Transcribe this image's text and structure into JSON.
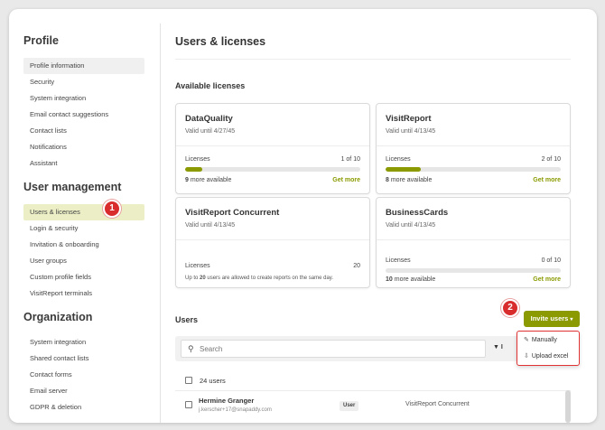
{
  "sidebar": {
    "profile": {
      "title": "Profile",
      "items": [
        "Profile information",
        "Security",
        "System integration",
        "Email contact suggestions",
        "Contact lists",
        "Notifications",
        "Assistant"
      ]
    },
    "user_management": {
      "title": "User management",
      "items": [
        "Users & licenses",
        "Login & security",
        "Invitation & onboarding",
        "User groups",
        "Custom profile fields",
        "VisitReport terminals"
      ]
    },
    "organization": {
      "title": "Organization",
      "items": [
        "System integration",
        "Shared contact lists",
        "Contact forms",
        "Email server",
        "GDPR & deletion"
      ]
    }
  },
  "steps": {
    "one": "1",
    "two": "2"
  },
  "main": {
    "title": "Users & licenses",
    "licenses_title": "Available licenses",
    "cards": [
      {
        "name": "DataQuality",
        "valid": "Valid until 4/27/45",
        "label": "Licenses",
        "count": "1 of 10",
        "fill": 0.1,
        "avail_num": "9",
        "avail_text": " more available",
        "more": "Get more"
      },
      {
        "name": "VisitReport",
        "valid": "Valid until 4/13/45",
        "label": "Licenses",
        "count": "2 of 10",
        "fill": 0.2,
        "avail_num": "8",
        "avail_text": " more available",
        "more": "Get more"
      },
      {
        "name": "VisitReport Concurrent",
        "valid": "Valid until 4/13/45",
        "label": "Licenses",
        "count": "20",
        "note_pre": "Up to ",
        "note_num": "20",
        "note_post": " users are allowed to create reports on the same day."
      },
      {
        "name": "BusinessCards",
        "valid": "Valid until 4/13/45",
        "label": "Licenses",
        "count": "0 of 10",
        "fill": 0.0,
        "avail_num": "10",
        "avail_text": " more available",
        "more": "Get more"
      }
    ],
    "users_title": "Users",
    "invite_label": "Invite users",
    "invite_menu": [
      "Manually",
      "Upload excel"
    ],
    "search_placeholder": "Search",
    "filter_label": "▼ I",
    "user_count": "24 users",
    "users": [
      {
        "name": "Hermine Granger",
        "email": "j.kerscher+17@snapaddy.com",
        "role": "User",
        "license": "VisitReport Concurrent"
      }
    ]
  }
}
